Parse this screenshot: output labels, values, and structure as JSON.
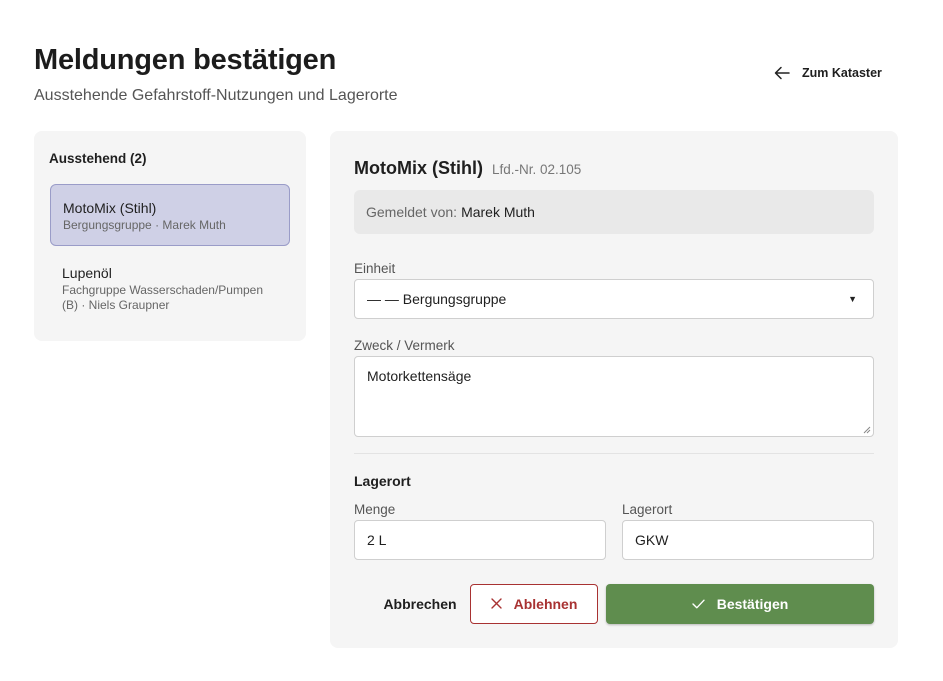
{
  "header": {
    "title": "Meldungen bestätigen",
    "subtitle": "Ausstehende Gefahrstoff-Nutzungen und Lagerorte",
    "back_label": "Zum Kataster"
  },
  "sidebar": {
    "title": "Ausstehend (2)",
    "items": [
      {
        "name": "MotoMix (Stihl)",
        "meta": "Bergungsgruppe · Marek Muth",
        "active": true
      },
      {
        "name": "Lupenöl",
        "meta": "Fachgruppe Wasserschaden/Pumpen (B) · Niels Graupner",
        "active": false
      }
    ]
  },
  "detail": {
    "title": "MotoMix (Stihl)",
    "lfd": "Lfd.-Nr. 02.105",
    "reported_label": "Gemeldet von:",
    "reported_name": "Marek Muth",
    "unit_label": "Einheit",
    "unit_value": "— — Bergungsgruppe",
    "purpose_label": "Zweck / Vermerk",
    "purpose_value": "Motorkettensäge",
    "storage_section": "Lagerort",
    "amount_label": "Menge",
    "amount_value": "2 L",
    "location_label": "Lagerort",
    "location_value": "GKW"
  },
  "actions": {
    "cancel": "Abbrechen",
    "reject": "Ablehnen",
    "confirm": "Bestätigen"
  },
  "colors": {
    "accent_green": "#5f8d4e",
    "reject_red": "#a83232",
    "active_item_bg": "#cfd0e6",
    "active_item_border": "#9a9cc8"
  }
}
